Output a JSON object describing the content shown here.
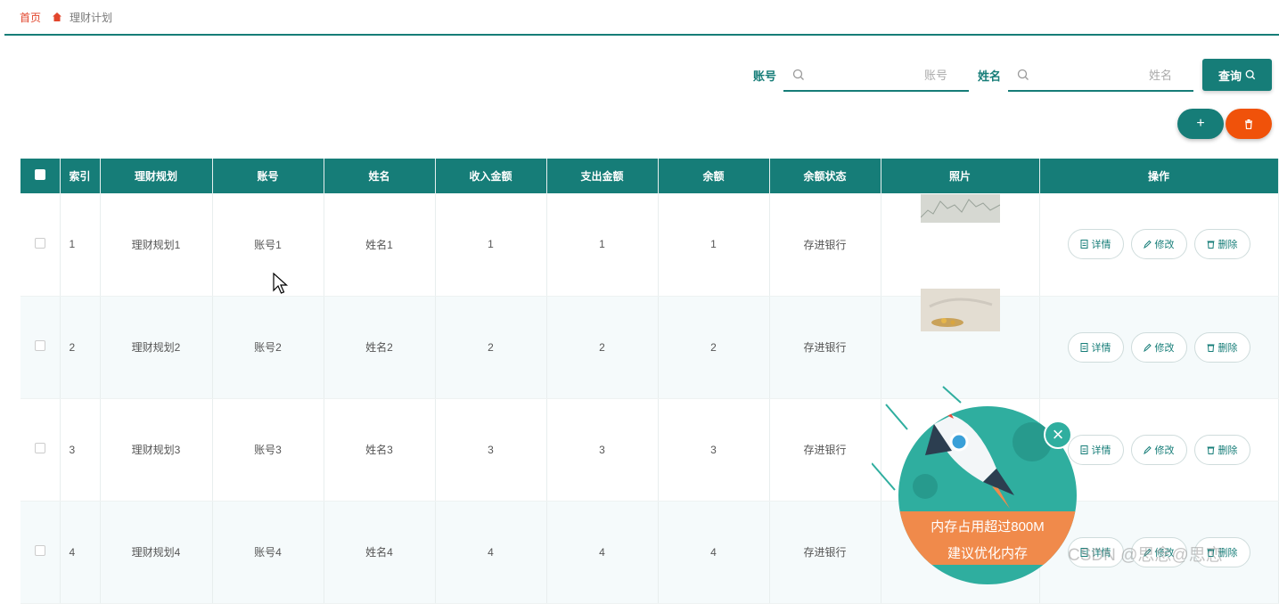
{
  "breadcrumb": {
    "home": "首页",
    "current": "理财计划"
  },
  "search": {
    "account_label": "账号",
    "account_placeholder": "账号",
    "name_label": "姓名",
    "name_placeholder": "姓名",
    "query_label": "查询"
  },
  "toolbar": {
    "add_label": "+"
  },
  "table": {
    "headers": [
      "索引",
      "理财规划",
      "账号",
      "姓名",
      "收入金额",
      "支出金额",
      "余额",
      "余额状态",
      "照片",
      "操作"
    ],
    "rows": [
      {
        "index": "1",
        "plan": "理财规划1",
        "account": "账号1",
        "name": "姓名1",
        "income": "1",
        "expense": "1",
        "balance": "1",
        "status": "存进银行"
      },
      {
        "index": "2",
        "plan": "理财规划2",
        "account": "账号2",
        "name": "姓名2",
        "income": "2",
        "expense": "2",
        "balance": "2",
        "status": "存进银行"
      },
      {
        "index": "3",
        "plan": "理财规划3",
        "account": "账号3",
        "name": "姓名3",
        "income": "3",
        "expense": "3",
        "balance": "3",
        "status": "存进银行"
      },
      {
        "index": "4",
        "plan": "理财规划4",
        "account": "账号4",
        "name": "姓名4",
        "income": "4",
        "expense": "4",
        "balance": "4",
        "status": "存进银行"
      }
    ],
    "actions": {
      "detail": "详情",
      "edit": "修改",
      "delete": "删除"
    }
  },
  "popup": {
    "line1": "内存占用超过800M",
    "line2": "建议优化内存",
    "close": "×"
  },
  "watermark": "CSDN @思念@思恋",
  "colors": {
    "accent": "#167d78",
    "danger": "#f0520a",
    "home": "#e2462c"
  }
}
